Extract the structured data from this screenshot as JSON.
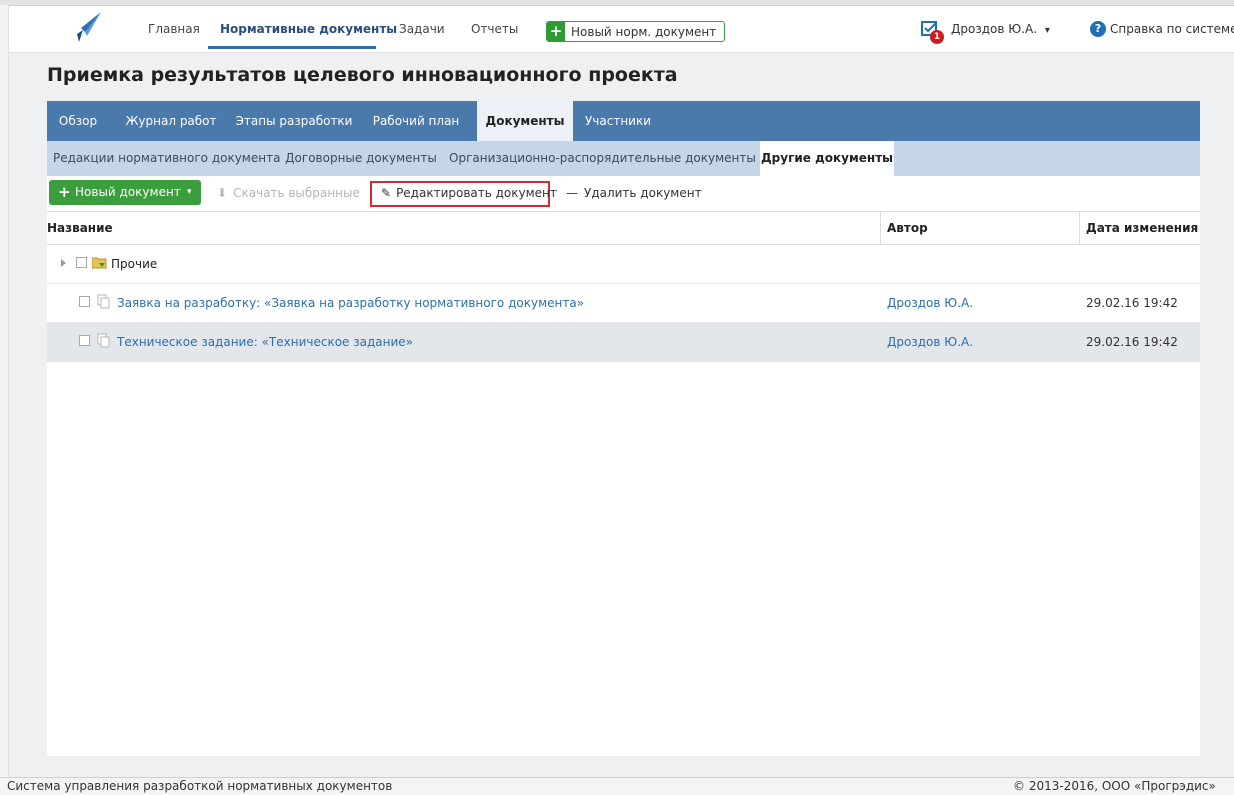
{
  "topnav": {
    "links": [
      "Главная",
      "Нормативные документы",
      "Задачи",
      "Отчеты"
    ],
    "new_doc_label": "Новый норм. документ",
    "tasks_badge": "1",
    "user_name": "Дроздов Ю.А.",
    "user_caret": "▾",
    "help_label": "Справка по системе",
    "help_glyph": "?"
  },
  "page": {
    "title": "Приемка результатов целевого инновационного проекта"
  },
  "tabs": [
    "Обзор",
    "Журнал работ",
    "Этапы разработки",
    "Рабочий план",
    "Документы",
    "Участники"
  ],
  "subtabs": [
    "Редакции нормативного документа",
    "Договорные документы",
    "Организационно-распорядительные документы",
    "Другие документы"
  ],
  "toolbar": {
    "new_label": "Новый документ",
    "new_caret": "▾",
    "plus": "+",
    "download_label": "Скачать выбранные",
    "download_glyph": "⬇",
    "edit_label": "Редактировать документ",
    "edit_glyph": "✎",
    "delete_label": "Удалить документ",
    "delete_glyph": "—"
  },
  "table": {
    "headers": {
      "name": "Название",
      "author": "Автор",
      "date": "Дата изменения"
    },
    "folder": {
      "name": "Прочие"
    },
    "rows": [
      {
        "name": "Заявка на разработку: «Заявка на разработку нормативного документа»",
        "author": "Дроздов Ю.А.",
        "date": "29.02.16 19:42"
      },
      {
        "name": "Техническое задание: «Техническое задание»",
        "author": "Дроздов Ю.А.",
        "date": "29.02.16 19:42"
      }
    ]
  },
  "status": {
    "left": "Система управления разработкой нормативных документов",
    "right": "© 2013-2016, ООО «Прогрэдис»"
  },
  "colors": {
    "tabbar": "#4a79ab",
    "subtabbar": "#c4d6e8",
    "link": "#2c6fb0",
    "green": "#3b9e3d",
    "highlight": "#d62b2b"
  }
}
